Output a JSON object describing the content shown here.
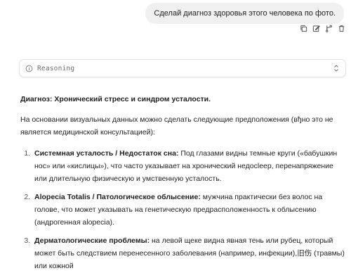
{
  "user_message": {
    "text": "Сделай диагноз здоровья этого человека по фото."
  },
  "message_actions": [
    {
      "icon": "copy-icon"
    },
    {
      "icon": "edit-icon"
    },
    {
      "icon": "branch-icon"
    },
    {
      "icon": "trash-icon"
    }
  ],
  "reasoning": {
    "label": "Reasoning"
  },
  "answer": {
    "diagnosis": "Диагноз: Хронический стресс и синдром усталости.",
    "intro": "На основании визуальных данных можно сделать следующие предположения (вђно это не является медицинской консультацией):",
    "items": [
      {
        "title": "Системная усталость / Недостаток сна:",
        "text": " Под глазами видны темные круги («бабушкин нос» или «кислицы»), что часто указывает на хронический недосleep, перенапряжение или длительную физическую и умственную усталость."
      },
      {
        "title": "Alopecia Totalis / Патологическое облысение:",
        "text": " мужчина практически без волос на голове, что может указывать на генетическую предрасположенность к облысению (андрогенная alopecia)."
      },
      {
        "title": "Дерматологические проблемы:",
        "text": " на левой щеке видна явная тень или рубец, который может быть следствием перенесенного заболевания (например, инфекции),旧伤 (травмы) или кожной"
      }
    ]
  }
}
